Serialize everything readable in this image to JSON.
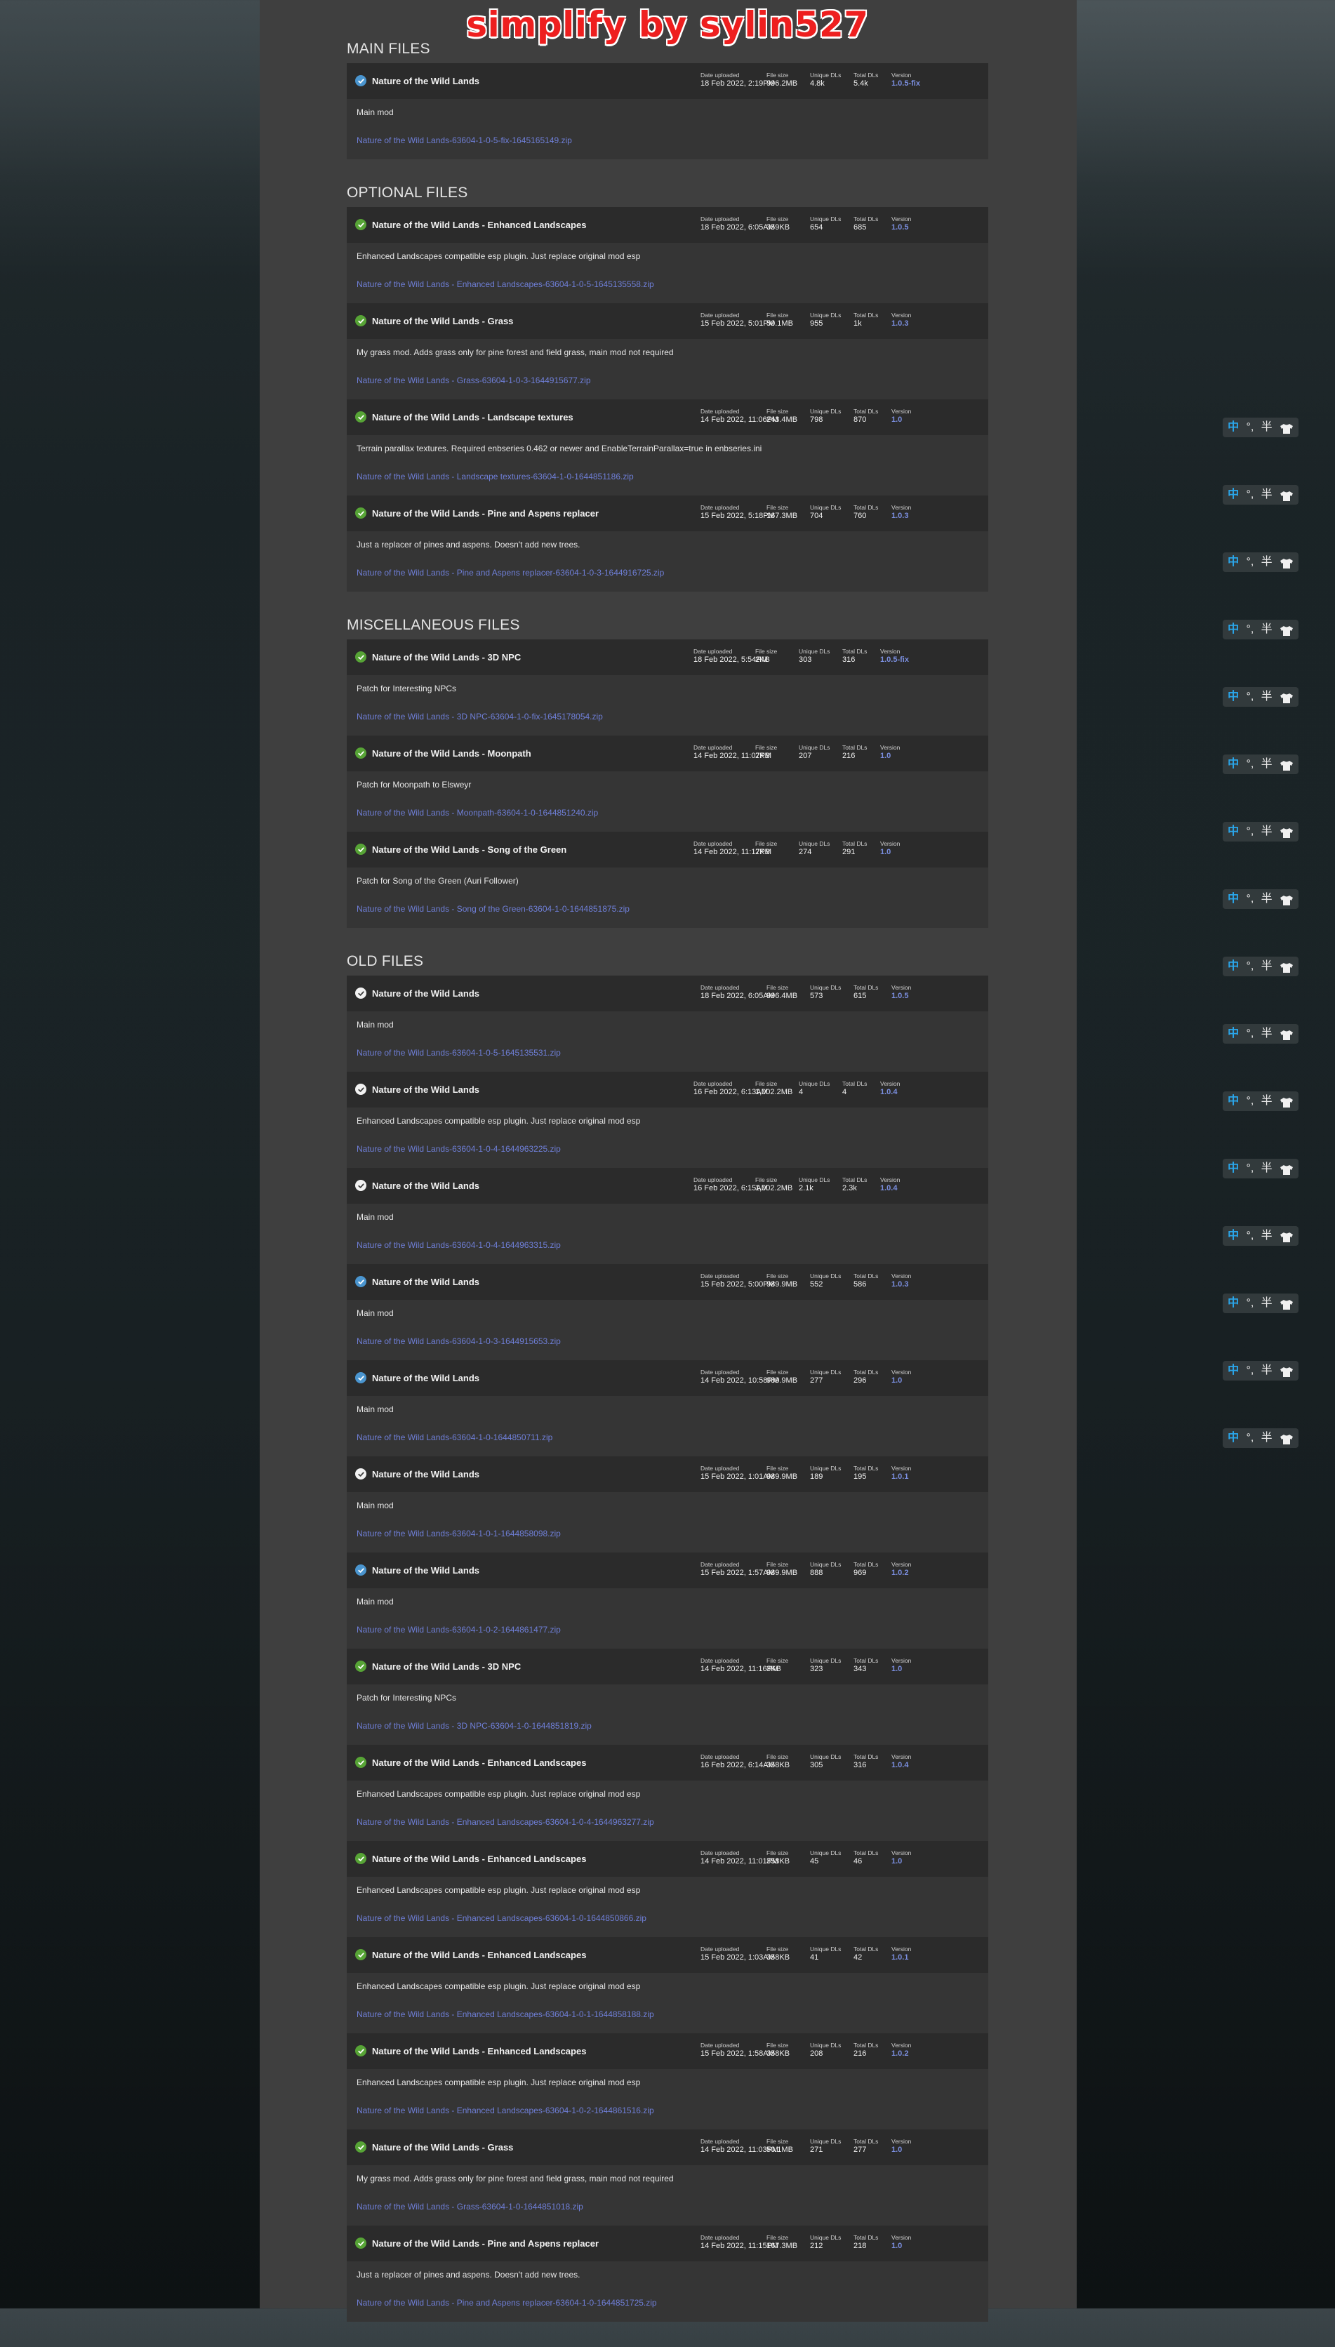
{
  "watermark": "simplify by sylin527",
  "labels": {
    "date": "Date uploaded",
    "size": "File size",
    "unique": "Unique DLs",
    "total": "Total DLs",
    "version": "Version"
  },
  "ime": {
    "zh": "中",
    "punct": "°,",
    "half": "半",
    "skin_icon": "shirt-icon",
    "count": 16
  },
  "sections": [
    {
      "title": "MAIN FILES",
      "files": [
        {
          "icon": "blue",
          "name": "Nature of the Wild Lands",
          "date": "18 Feb 2022, 2:19PM",
          "size": "996.2MB",
          "unique": "4.8k",
          "total": "5.4k",
          "version": "1.0.5-fix",
          "desc": "Main mod",
          "link": "Nature of the Wild Lands-63604-1-0-5-fix-1645165149.zip"
        }
      ]
    },
    {
      "title": "OPTIONAL FILES",
      "files": [
        {
          "icon": "green",
          "name": "Nature of the Wild Lands - Enhanced Landscapes",
          "date": "18 Feb 2022, 6:05AM",
          "size": "359KB",
          "unique": "654",
          "total": "685",
          "version": "1.0.5",
          "desc": "Enhanced Landscapes compatible esp plugin. Just replace original mod esp",
          "link": "Nature of the Wild Lands - Enhanced Landscapes-63604-1-0-5-1645135558.zip"
        },
        {
          "icon": "green",
          "name": "Nature of the Wild Lands - Grass",
          "date": "15 Feb 2022, 5:01PM",
          "size": "50.1MB",
          "unique": "955",
          "total": "1k",
          "version": "1.0.3",
          "desc": "My grass mod. Adds grass only for pine forest and field grass, main mod not required",
          "link": "Nature of the Wild Lands - Grass-63604-1-0-3-1644915677.zip"
        },
        {
          "icon": "green",
          "name": "Nature of the Wild Lands - Landscape textures",
          "date": "14 Feb 2022, 11:06PM",
          "size": "243.4MB",
          "unique": "798",
          "total": "870",
          "version": "1.0",
          "desc": "Terrain parallax textures. Required enbseries 0.462 or newer and EnableTerrainParallax=true in enbseries.ini",
          "link": "Nature of the Wild Lands - Landscape textures-63604-1-0-1644851186.zip"
        },
        {
          "icon": "green",
          "name": "Nature of the Wild Lands - Pine and Aspens replacer",
          "date": "15 Feb 2022, 5:18PM",
          "size": "167.3MB",
          "unique": "704",
          "total": "760",
          "version": "1.0.3",
          "desc": "Just a replacer of pines and aspens. Doesn't add new trees.",
          "link": "Nature of the Wild Lands - Pine and Aspens replacer-63604-1-0-3-1644916725.zip"
        }
      ]
    },
    {
      "title": "MISCELLANEOUS FILES",
      "files": [
        {
          "icon": "green",
          "name": "Nature of the Wild Lands - 3D NPC",
          "date": "18 Feb 2022, 5:54PM",
          "size": "2KB",
          "unique": "303",
          "total": "316",
          "version": "1.0.5-fix",
          "desc": "Patch for Interesting NPCs",
          "link": "Nature of the Wild Lands - 3D NPC-63604-1-0-fix-1645178054.zip"
        },
        {
          "icon": "green",
          "name": "Nature of the Wild Lands - Moonpath",
          "date": "14 Feb 2022, 11:07PM",
          "size": "2KB",
          "unique": "207",
          "total": "216",
          "version": "1.0",
          "desc": "Patch for Moonpath to Elsweyr",
          "link": "Nature of the Wild Lands - Moonpath-63604-1-0-1644851240.zip"
        },
        {
          "icon": "green",
          "name": "Nature of the Wild Lands - Song of the Green",
          "date": "14 Feb 2022, 11:17PM",
          "size": "2KB",
          "unique": "274",
          "total": "291",
          "version": "1.0",
          "desc": "Patch for Song of the Green (Auri Follower)",
          "link": "Nature of the Wild Lands - Song of the Green-63604-1-0-1644851875.zip"
        }
      ]
    },
    {
      "title": "OLD FILES",
      "files": [
        {
          "icon": "white",
          "name": "Nature of the Wild Lands",
          "date": "18 Feb 2022, 6:05AM",
          "size": "996.4MB",
          "unique": "573",
          "total": "615",
          "version": "1.0.5",
          "desc": "Main mod",
          "link": "Nature of the Wild Lands-63604-1-0-5-1645135531.zip"
        },
        {
          "icon": "white",
          "name": "Nature of the Wild Lands",
          "date": "16 Feb 2022, 6:13AM",
          "size": "1,002.2MB",
          "unique": "4",
          "total": "4",
          "version": "1.0.4",
          "desc": "Enhanced Landscapes compatible esp plugin. Just replace original mod esp",
          "link": "Nature of the Wild Lands-63604-1-0-4-1644963225.zip"
        },
        {
          "icon": "white",
          "name": "Nature of the Wild Lands",
          "date": "16 Feb 2022, 6:15AM",
          "size": "1,002.2MB",
          "unique": "2.1k",
          "total": "2.3k",
          "version": "1.0.4",
          "desc": "Main mod",
          "link": "Nature of the Wild Lands-63604-1-0-4-1644963315.zip"
        },
        {
          "icon": "blue",
          "name": "Nature of the Wild Lands",
          "date": "15 Feb 2022, 5:00PM",
          "size": "989.9MB",
          "unique": "552",
          "total": "586",
          "version": "1.0.3",
          "desc": "Main mod",
          "link": "Nature of the Wild Lands-63604-1-0-3-1644915653.zip"
        },
        {
          "icon": "blue",
          "name": "Nature of the Wild Lands",
          "date": "14 Feb 2022, 10:58PM",
          "size": "989.9MB",
          "unique": "277",
          "total": "296",
          "version": "1.0",
          "desc": "Main mod",
          "link": "Nature of the Wild Lands-63604-1-0-1644850711.zip"
        },
        {
          "icon": "white",
          "name": "Nature of the Wild Lands",
          "date": "15 Feb 2022, 1:01AM",
          "size": "989.9MB",
          "unique": "189",
          "total": "195",
          "version": "1.0.1",
          "desc": "Main mod",
          "link": "Nature of the Wild Lands-63604-1-0-1-1644858098.zip"
        },
        {
          "icon": "blue",
          "name": "Nature of the Wild Lands",
          "date": "15 Feb 2022, 1:57AM",
          "size": "989.9MB",
          "unique": "888",
          "total": "969",
          "version": "1.0.2",
          "desc": "Main mod",
          "link": "Nature of the Wild Lands-63604-1-0-2-1644861477.zip"
        },
        {
          "icon": "green",
          "name": "Nature of the Wild Lands - 3D NPC",
          "date": "14 Feb 2022, 11:16PM",
          "size": "3KB",
          "unique": "323",
          "total": "343",
          "version": "1.0",
          "desc": "Patch for Interesting NPCs",
          "link": "Nature of the Wild Lands - 3D NPC-63604-1-0-1644851819.zip"
        },
        {
          "icon": "green",
          "name": "Nature of the Wild Lands - Enhanced Landscapes",
          "date": "16 Feb 2022, 6:14AM",
          "size": "358KB",
          "unique": "305",
          "total": "316",
          "version": "1.0.4",
          "desc": "Enhanced Landscapes compatible esp plugin. Just replace original mod esp",
          "link": "Nature of the Wild Lands - Enhanced Landscapes-63604-1-0-4-1644963277.zip"
        },
        {
          "icon": "green",
          "name": "Nature of the Wild Lands - Enhanced Landscapes",
          "date": "14 Feb 2022, 11:01PM",
          "size": "358KB",
          "unique": "45",
          "total": "46",
          "version": "1.0",
          "desc": "Enhanced Landscapes compatible esp plugin. Just replace original mod esp",
          "link": "Nature of the Wild Lands - Enhanced Landscapes-63604-1-0-1644850866.zip"
        },
        {
          "icon": "green",
          "name": "Nature of the Wild Lands - Enhanced Landscapes",
          "date": "15 Feb 2022, 1:03AM",
          "size": "358KB",
          "unique": "41",
          "total": "42",
          "version": "1.0.1",
          "desc": "Enhanced Landscapes compatible esp plugin. Just replace original mod esp",
          "link": "Nature of the Wild Lands - Enhanced Landscapes-63604-1-0-1-1644858188.zip"
        },
        {
          "icon": "green",
          "name": "Nature of the Wild Lands - Enhanced Landscapes",
          "date": "15 Feb 2022, 1:58AM",
          "size": "358KB",
          "unique": "208",
          "total": "216",
          "version": "1.0.2",
          "desc": "Enhanced Landscapes compatible esp plugin. Just replace original mod esp",
          "link": "Nature of the Wild Lands - Enhanced Landscapes-63604-1-0-2-1644861516.zip"
        },
        {
          "icon": "green",
          "name": "Nature of the Wild Lands - Grass",
          "date": "14 Feb 2022, 11:03PM",
          "size": "50.1MB",
          "unique": "271",
          "total": "277",
          "version": "1.0",
          "desc": "My grass mod. Adds grass only for pine forest and field grass, main mod not required",
          "link": "Nature of the Wild Lands - Grass-63604-1-0-1644851018.zip"
        },
        {
          "icon": "green",
          "name": "Nature of the Wild Lands - Pine and Aspens replacer",
          "date": "14 Feb 2022, 11:15PM",
          "size": "167.3MB",
          "unique": "212",
          "total": "218",
          "version": "1.0",
          "desc": "Just a replacer of pines and aspens. Doesn't add new trees.",
          "link": "Nature of the Wild Lands - Pine and Aspens replacer-63604-1-0-1644851725.zip"
        }
      ]
    }
  ]
}
